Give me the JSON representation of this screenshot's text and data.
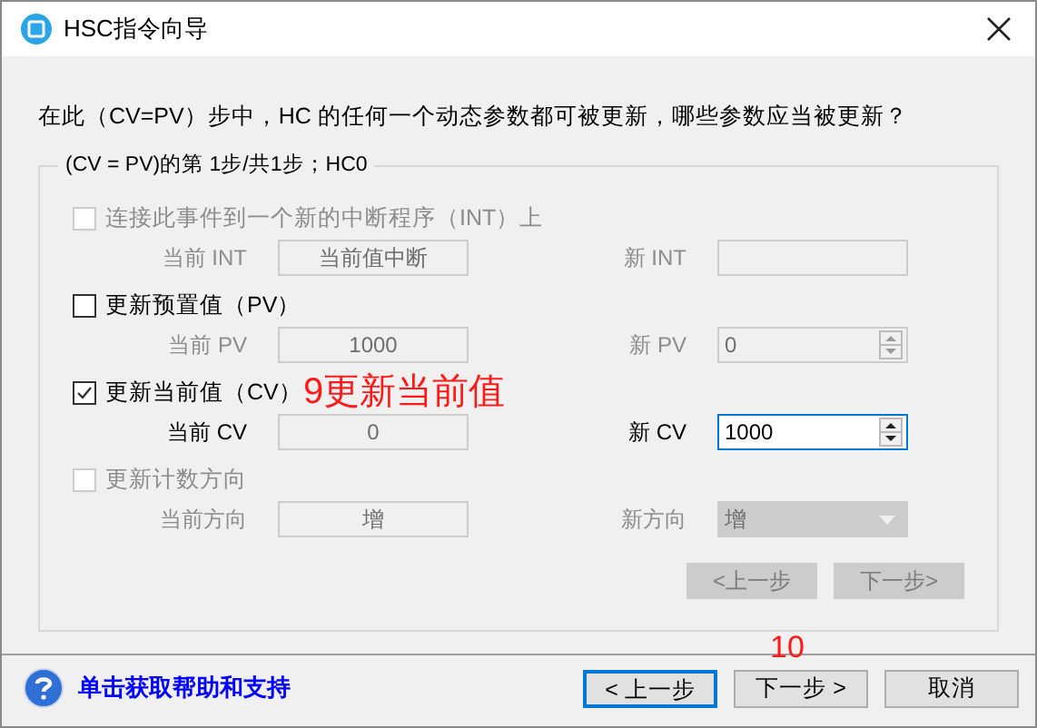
{
  "window": {
    "title": "HSC指令向导"
  },
  "question": "在此（CV=PV）步中，HC 的任何一个动态参数都可被更新，哪些参数应当被更新？",
  "group": {
    "title": "(CV = PV)的第 1步/共1步；HC0",
    "params": [
      {
        "label": "连接此事件到一个新的中断程序（INT）上",
        "checked": false,
        "disabled": true,
        "current_label": "当前 INT",
        "current_value": "当前值中断",
        "new_label": "新 INT",
        "kind": "text"
      },
      {
        "label": "更新预置值（PV）",
        "checked": false,
        "disabled": false,
        "current_label": "当前 PV",
        "current_value": "1000",
        "new_label": "新 PV",
        "new_value": "0",
        "kind": "spin"
      },
      {
        "label": "更新当前值（CV）",
        "checked": true,
        "disabled": false,
        "current_label": "当前 CV",
        "current_value": "0",
        "new_label": "新 CV",
        "new_value": "1000",
        "kind": "spin"
      },
      {
        "label": "更新计数方向",
        "checked": false,
        "disabled": true,
        "current_label": "当前方向",
        "current_value": "增",
        "new_label": "新方向",
        "new_value": "增",
        "kind": "combo"
      }
    ],
    "step_buttons": [
      {
        "label": "<上一步",
        "disabled": true
      },
      {
        "label": "下一步>",
        "disabled": true
      }
    ]
  },
  "help_link": "单击获取帮助和支持",
  "buttons": [
    {
      "label": "< 上一步",
      "default": true
    },
    {
      "label": "下一步 >",
      "default": false
    },
    {
      "label": "取消",
      "default": false
    }
  ],
  "annotations": [
    "9更新当前值",
    "10"
  ]
}
